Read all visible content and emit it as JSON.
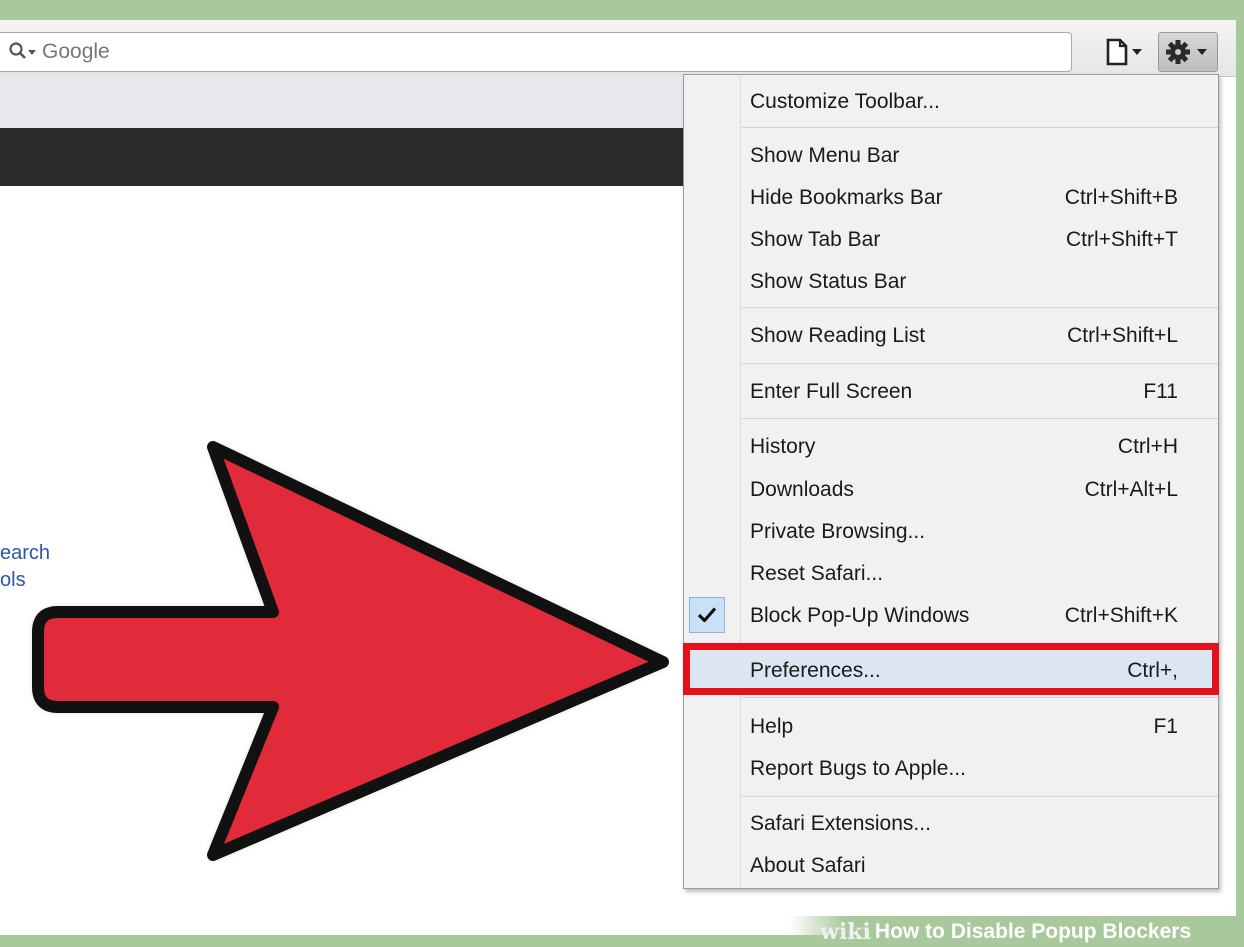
{
  "search": {
    "placeholder": "Google"
  },
  "page_side_links": [
    "earch",
    "ols"
  ],
  "menu": {
    "items": [
      {
        "label": "Customize Toolbar...",
        "shortcut": ""
      },
      {
        "label": "Show Menu Bar",
        "shortcut": ""
      },
      {
        "label": "Hide Bookmarks Bar",
        "shortcut": "Ctrl+Shift+B"
      },
      {
        "label": "Show Tab Bar",
        "shortcut": "Ctrl+Shift+T"
      },
      {
        "label": "Show Status Bar",
        "shortcut": ""
      },
      {
        "label": "Show Reading List",
        "shortcut": "Ctrl+Shift+L"
      },
      {
        "label": "Enter Full Screen",
        "shortcut": "F11"
      },
      {
        "label": "History",
        "shortcut": "Ctrl+H"
      },
      {
        "label": "Downloads",
        "shortcut": "Ctrl+Alt+L"
      },
      {
        "label": "Private Browsing...",
        "shortcut": ""
      },
      {
        "label": "Reset Safari...",
        "shortcut": ""
      },
      {
        "label": "Block Pop-Up Windows",
        "shortcut": "Ctrl+Shift+K",
        "checked": true
      },
      {
        "label": "Preferences...",
        "shortcut": "Ctrl+,",
        "highlighted": true
      },
      {
        "label": "Help",
        "shortcut": "F1"
      },
      {
        "label": "Report Bugs to Apple...",
        "shortcut": ""
      },
      {
        "label": "Safari Extensions...",
        "shortcut": ""
      },
      {
        "label": "About Safari",
        "shortcut": ""
      }
    ]
  },
  "icons": {
    "search": "magnifier-dropdown-icon",
    "page": "page-menu-icon",
    "gear": "gear-icon",
    "check": "checkmark-icon",
    "arrow": "red-arrow-pointer"
  },
  "colors": {
    "frame": "#a7c99b",
    "highlight_border": "#e4101a",
    "arrow_fill": "#e12b3a",
    "menu_bg": "#f1f1f1",
    "hover_bg": "#dce6f2"
  },
  "watermark": {
    "brand": "wiki",
    "title": "How to Disable Popup Blockers"
  }
}
